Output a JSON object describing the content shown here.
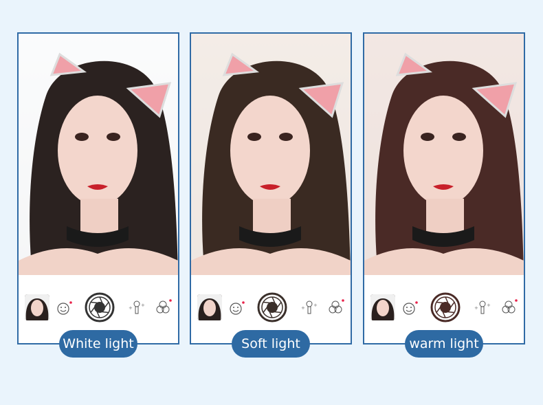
{
  "panels": [
    {
      "label": "White light",
      "tint": "#ffffff",
      "hair": "#2b2220",
      "shutter_color": "#333333"
    },
    {
      "label": "Soft light",
      "tint": "#f3e6dc",
      "hair": "#3a2a22",
      "shutter_color": "#3a2f2a"
    },
    {
      "label": "warm light",
      "tint": "#f2ddd6",
      "hair": "#4a2a26",
      "shutter_color": "#4a2a26"
    }
  ],
  "icons": [
    "avatar-thumbnail",
    "face-sticker-icon",
    "shutter-icon",
    "beauty-brush-icon",
    "filter-icon"
  ],
  "colors": {
    "accent": "#2e6aa3",
    "background": "#eaf4fc",
    "notification_dot": "#e8234a"
  }
}
